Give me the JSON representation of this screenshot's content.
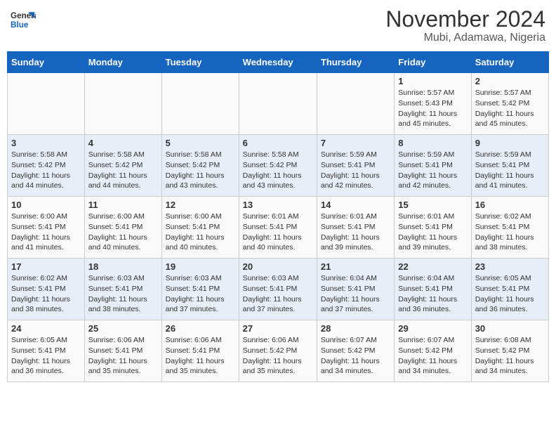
{
  "header": {
    "logo_line1": "General",
    "logo_line2": "Blue",
    "title": "November 2024",
    "subtitle": "Mubi, Adamawa, Nigeria"
  },
  "days_of_week": [
    "Sunday",
    "Monday",
    "Tuesday",
    "Wednesday",
    "Thursday",
    "Friday",
    "Saturday"
  ],
  "weeks": [
    [
      {
        "day": "",
        "info": ""
      },
      {
        "day": "",
        "info": ""
      },
      {
        "day": "",
        "info": ""
      },
      {
        "day": "",
        "info": ""
      },
      {
        "day": "",
        "info": ""
      },
      {
        "day": "1",
        "info": "Sunrise: 5:57 AM\nSunset: 5:43 PM\nDaylight: 11 hours and 45 minutes."
      },
      {
        "day": "2",
        "info": "Sunrise: 5:57 AM\nSunset: 5:42 PM\nDaylight: 11 hours and 45 minutes."
      }
    ],
    [
      {
        "day": "3",
        "info": "Sunrise: 5:58 AM\nSunset: 5:42 PM\nDaylight: 11 hours and 44 minutes."
      },
      {
        "day": "4",
        "info": "Sunrise: 5:58 AM\nSunset: 5:42 PM\nDaylight: 11 hours and 44 minutes."
      },
      {
        "day": "5",
        "info": "Sunrise: 5:58 AM\nSunset: 5:42 PM\nDaylight: 11 hours and 43 minutes."
      },
      {
        "day": "6",
        "info": "Sunrise: 5:58 AM\nSunset: 5:42 PM\nDaylight: 11 hours and 43 minutes."
      },
      {
        "day": "7",
        "info": "Sunrise: 5:59 AM\nSunset: 5:41 PM\nDaylight: 11 hours and 42 minutes."
      },
      {
        "day": "8",
        "info": "Sunrise: 5:59 AM\nSunset: 5:41 PM\nDaylight: 11 hours and 42 minutes."
      },
      {
        "day": "9",
        "info": "Sunrise: 5:59 AM\nSunset: 5:41 PM\nDaylight: 11 hours and 41 minutes."
      }
    ],
    [
      {
        "day": "10",
        "info": "Sunrise: 6:00 AM\nSunset: 5:41 PM\nDaylight: 11 hours and 41 minutes."
      },
      {
        "day": "11",
        "info": "Sunrise: 6:00 AM\nSunset: 5:41 PM\nDaylight: 11 hours and 40 minutes."
      },
      {
        "day": "12",
        "info": "Sunrise: 6:00 AM\nSunset: 5:41 PM\nDaylight: 11 hours and 40 minutes."
      },
      {
        "day": "13",
        "info": "Sunrise: 6:01 AM\nSunset: 5:41 PM\nDaylight: 11 hours and 40 minutes."
      },
      {
        "day": "14",
        "info": "Sunrise: 6:01 AM\nSunset: 5:41 PM\nDaylight: 11 hours and 39 minutes."
      },
      {
        "day": "15",
        "info": "Sunrise: 6:01 AM\nSunset: 5:41 PM\nDaylight: 11 hours and 39 minutes."
      },
      {
        "day": "16",
        "info": "Sunrise: 6:02 AM\nSunset: 5:41 PM\nDaylight: 11 hours and 38 minutes."
      }
    ],
    [
      {
        "day": "17",
        "info": "Sunrise: 6:02 AM\nSunset: 5:41 PM\nDaylight: 11 hours and 38 minutes."
      },
      {
        "day": "18",
        "info": "Sunrise: 6:03 AM\nSunset: 5:41 PM\nDaylight: 11 hours and 38 minutes."
      },
      {
        "day": "19",
        "info": "Sunrise: 6:03 AM\nSunset: 5:41 PM\nDaylight: 11 hours and 37 minutes."
      },
      {
        "day": "20",
        "info": "Sunrise: 6:03 AM\nSunset: 5:41 PM\nDaylight: 11 hours and 37 minutes."
      },
      {
        "day": "21",
        "info": "Sunrise: 6:04 AM\nSunset: 5:41 PM\nDaylight: 11 hours and 37 minutes."
      },
      {
        "day": "22",
        "info": "Sunrise: 6:04 AM\nSunset: 5:41 PM\nDaylight: 11 hours and 36 minutes."
      },
      {
        "day": "23",
        "info": "Sunrise: 6:05 AM\nSunset: 5:41 PM\nDaylight: 11 hours and 36 minutes."
      }
    ],
    [
      {
        "day": "24",
        "info": "Sunrise: 6:05 AM\nSunset: 5:41 PM\nDaylight: 11 hours and 36 minutes."
      },
      {
        "day": "25",
        "info": "Sunrise: 6:06 AM\nSunset: 5:41 PM\nDaylight: 11 hours and 35 minutes."
      },
      {
        "day": "26",
        "info": "Sunrise: 6:06 AM\nSunset: 5:41 PM\nDaylight: 11 hours and 35 minutes."
      },
      {
        "day": "27",
        "info": "Sunrise: 6:06 AM\nSunset: 5:42 PM\nDaylight: 11 hours and 35 minutes."
      },
      {
        "day": "28",
        "info": "Sunrise: 6:07 AM\nSunset: 5:42 PM\nDaylight: 11 hours and 34 minutes."
      },
      {
        "day": "29",
        "info": "Sunrise: 6:07 AM\nSunset: 5:42 PM\nDaylight: 11 hours and 34 minutes."
      },
      {
        "day": "30",
        "info": "Sunrise: 6:08 AM\nSunset: 5:42 PM\nDaylight: 11 hours and 34 minutes."
      }
    ]
  ]
}
